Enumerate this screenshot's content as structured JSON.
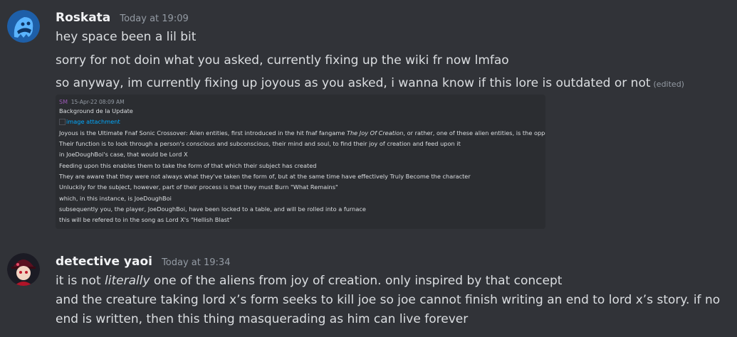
{
  "messages": [
    {
      "author": "Roskata",
      "timestamp": "Today at 19:09",
      "lines": [
        "hey space been a lil bit",
        "sorry for not doin what you asked, currently fixing up the wiki fr now lmfao",
        "so anyway, im currently fixing up joyous as you asked, i wanna know if this lore is outdated or not"
      ],
      "edited_label": "(edited)",
      "attachment": {
        "author_initials": "SM",
        "date": "15-Apr-22 08:09 AM",
        "title": "Background de la Update",
        "image_link_text": "image attachment",
        "line_before": "Joyous is the Ultimate Fnaf Sonic Crossover: Alien entities, first introduced in the hit fnaf fangame ",
        "line_italic": "The Joy Of Creation",
        "line_after": ", or rather, one of these alien entities, is the opponent",
        "lines": [
          "Their function is to look through a person's conscious and subconscious, their mind and soul, to find their joy of creation and feed upon it",
          "in JoeDoughBoi's case, that would be Lord X",
          "Feeding upon this enables them to take the form of that which their subject has created",
          "They are aware that they were not always what they've taken the form of, but at the same time have effectively Truly Become the character",
          "Unluckily for the subject, however, part of their process is that they must Burn \"What Remains\"",
          "which, in this instance, is JoeDoughBoi",
          "subsequently you, the player, JoeDoughBoi, have been locked to a table, and will be rolled into a furnace",
          "this will be refered to in the song as Lord X's \"Hellish Blast\""
        ]
      }
    },
    {
      "author": "detective yaoi",
      "timestamp": "Today at 19:34",
      "line1_before": "it is not ",
      "line1_italic": "literally",
      "line1_after": " one of the aliens from joy of creation. only inspired by that concept",
      "line2": "and the creature taking lord x’s form seeks to kill joe so joe cannot finish writing an end to lord x’s story. if no",
      "line3": "end is written, then this thing masquerading as him can live forever"
    }
  ],
  "colors": {
    "background": "#313338",
    "embed_background": "#2b2d31",
    "username": "#f2f3f5",
    "muted": "#949ba4",
    "link": "#00a8fc"
  },
  "icons": {
    "avatar1": "blue-ghost-avatar",
    "avatar2": "detective-character-avatar"
  }
}
